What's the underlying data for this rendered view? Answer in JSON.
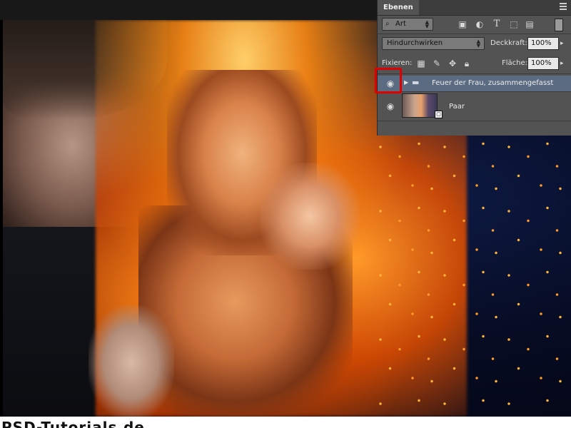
{
  "panel": {
    "tab_label": "Ebenen",
    "filter_label": "Art",
    "blend_mode": "Hindurchwirken",
    "opacity_label": "Deckkraft:",
    "opacity_value": "100%",
    "lock_label": "Fixieren:",
    "fill_label": "Fläche:",
    "fill_value": "100%",
    "icons": [
      "search-icon",
      "image-filter-icon",
      "adjustment-filter-icon",
      "type-filter-icon",
      "shape-filter-icon",
      "smart-object-filter-icon",
      "lock-transparent-icon",
      "lock-paint-icon",
      "lock-move-icon",
      "lock-all-icon"
    ]
  },
  "layers": [
    {
      "name": "Feuer der Frau, zusammengefasst",
      "type": "group",
      "visible": true,
      "selected": true
    },
    {
      "name": "Paar",
      "type": "smart-object",
      "visible": true,
      "selected": false
    }
  ],
  "footer": {
    "text": "PSD-Tutorials.de"
  },
  "colors": {
    "highlight": "#e10000",
    "selection": "#5a6b82",
    "panel_bg": "#535353"
  }
}
